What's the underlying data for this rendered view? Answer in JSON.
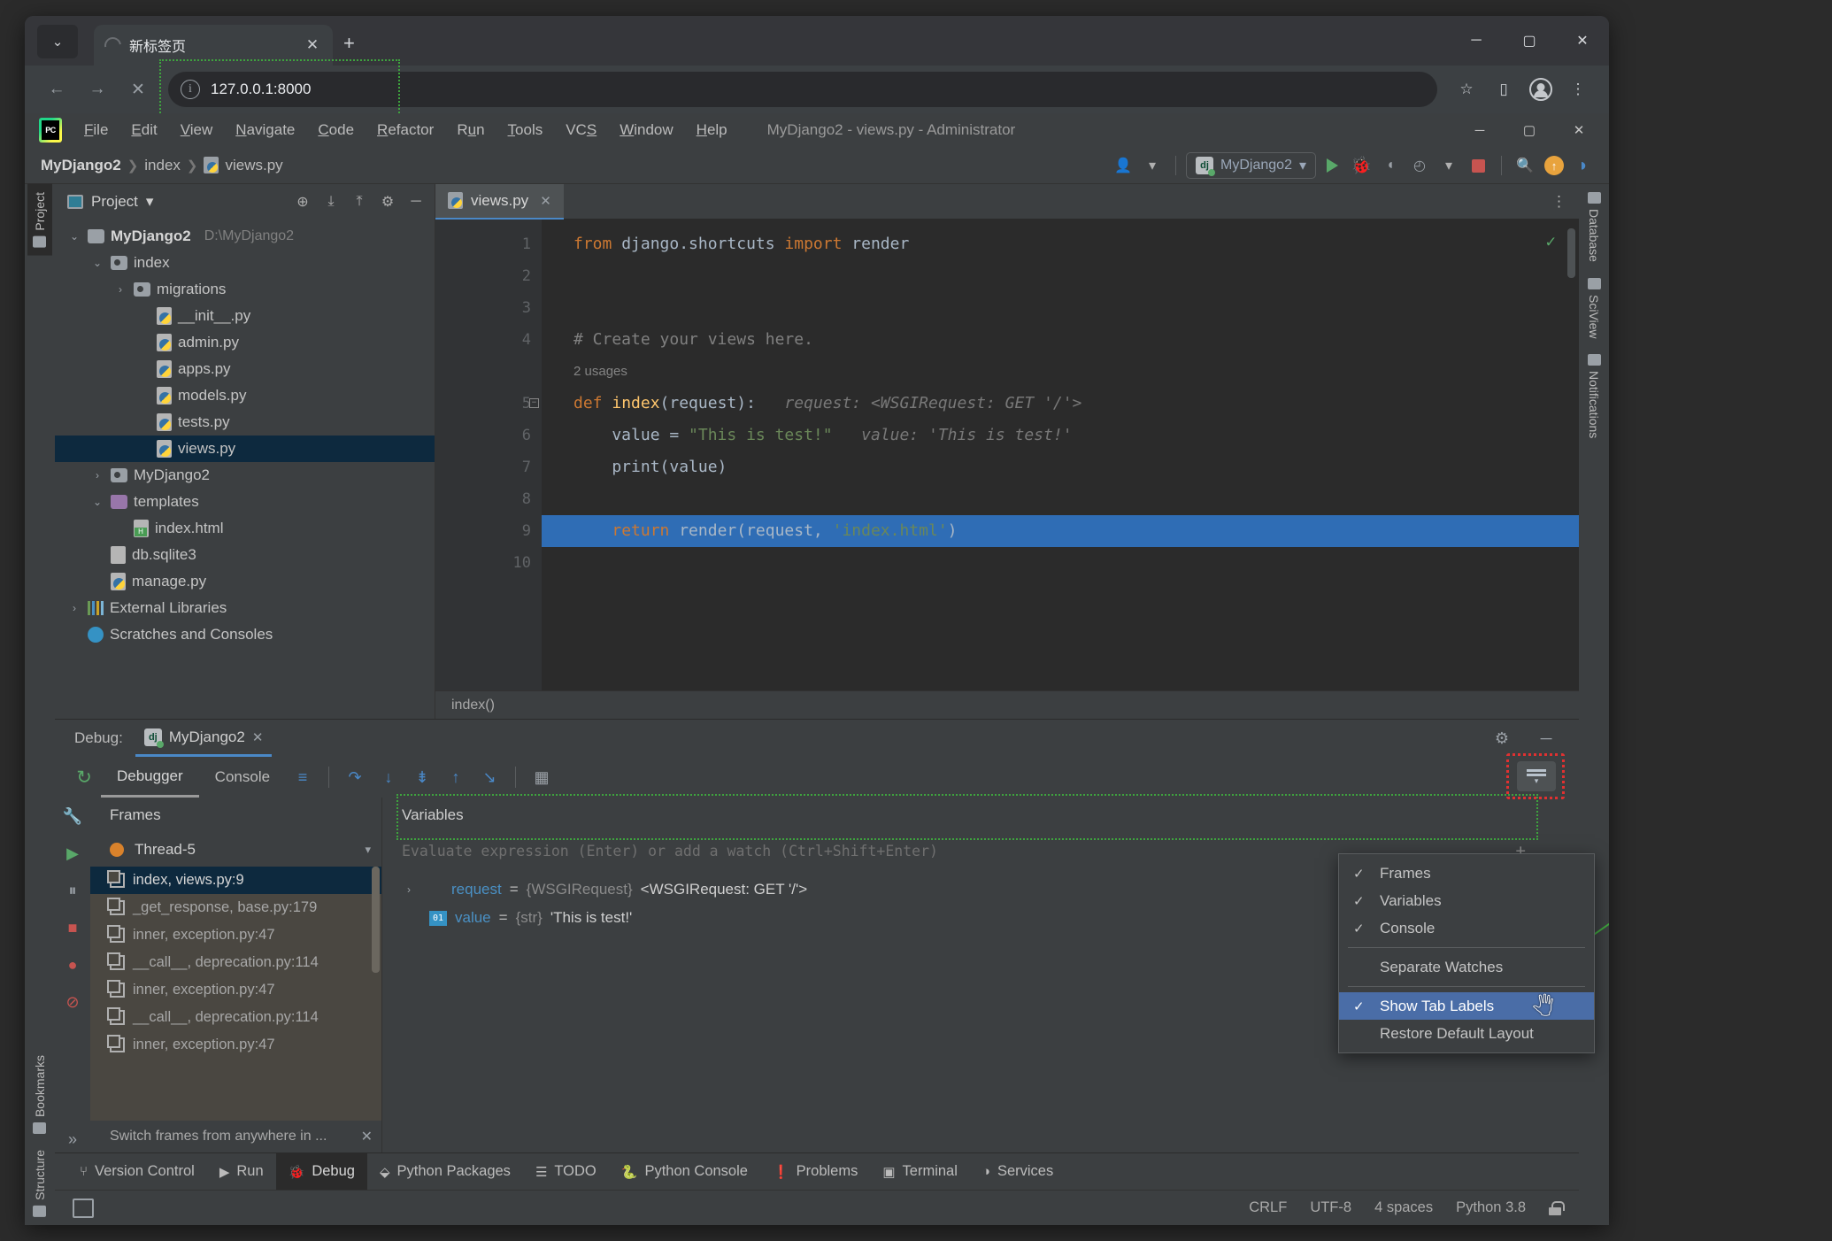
{
  "browser": {
    "tab_title": "新标签页",
    "tab_close": "✕",
    "new_tab": "+",
    "url": "127.0.0.1:8000",
    "info_icon": "i",
    "back": "←",
    "forward": "→",
    "stop": "✕",
    "star": "☆",
    "split": "▯",
    "menu": "⋮",
    "minimize": "─",
    "maximize": "▢",
    "close": "✕"
  },
  "ide": {
    "logo_text": "PC",
    "menu": [
      {
        "pre": "",
        "u": "F",
        "post": "ile"
      },
      {
        "pre": "",
        "u": "E",
        "post": "dit"
      },
      {
        "pre": "",
        "u": "V",
        "post": "iew"
      },
      {
        "pre": "",
        "u": "N",
        "post": "avigate"
      },
      {
        "pre": "",
        "u": "C",
        "post": "ode"
      },
      {
        "pre": "",
        "u": "R",
        "post": "efactor"
      },
      {
        "pre": "R",
        "u": "u",
        "post": "n"
      },
      {
        "pre": "",
        "u": "T",
        "post": "ools"
      },
      {
        "pre": "VC",
        "u": "S",
        "post": ""
      },
      {
        "pre": "",
        "u": "W",
        "post": "indow"
      },
      {
        "pre": "",
        "u": "H",
        "post": "elp"
      }
    ],
    "window_title": "MyDjango2 - views.py - Administrator",
    "win_minimize": "─",
    "win_maximize": "▢",
    "win_close": "✕"
  },
  "breadcrumb": {
    "project": "MyDjango2",
    "sep": "❯",
    "package": "index",
    "file": "views.py"
  },
  "toolbar": {
    "user_icon": "👤",
    "dropdown": "▾",
    "run_config": "MyDjango2",
    "dj_badge": "dj",
    "search_icon": "🔍",
    "update_icon": "↑"
  },
  "project_panel": {
    "title": "Project",
    "dropdown": "▾",
    "locate_icon": "⊕",
    "expand_icon": "⤓",
    "collapse_icon": "⤒",
    "settings_icon": "⚙",
    "hide_icon": "─",
    "tree": [
      {
        "depth": 0,
        "arrow": "⌄",
        "icon": "folder",
        "label": "MyDjango2",
        "bold": true,
        "path": "D:\\MyDjango2",
        "selected": false
      },
      {
        "depth": 1,
        "arrow": "⌄",
        "icon": "folder-mod",
        "label": "index",
        "bold": false,
        "path": "",
        "selected": false
      },
      {
        "depth": 2,
        "arrow": "›",
        "icon": "folder-mod",
        "label": "migrations",
        "bold": false,
        "path": "",
        "selected": false
      },
      {
        "depth": 3,
        "arrow": "",
        "icon": "py",
        "label": "__init__.py",
        "bold": false,
        "path": "",
        "selected": false
      },
      {
        "depth": 3,
        "arrow": "",
        "icon": "py",
        "label": "admin.py",
        "bold": false,
        "path": "",
        "selected": false
      },
      {
        "depth": 3,
        "arrow": "",
        "icon": "py",
        "label": "apps.py",
        "bold": false,
        "path": "",
        "selected": false
      },
      {
        "depth": 3,
        "arrow": "",
        "icon": "py",
        "label": "models.py",
        "bold": false,
        "path": "",
        "selected": false
      },
      {
        "depth": 3,
        "arrow": "",
        "icon": "py",
        "label": "tests.py",
        "bold": false,
        "path": "",
        "selected": false
      },
      {
        "depth": 3,
        "arrow": "",
        "icon": "py",
        "label": "views.py",
        "bold": false,
        "path": "",
        "selected": true
      },
      {
        "depth": 1,
        "arrow": "›",
        "icon": "folder-mod",
        "label": "MyDjango2",
        "bold": false,
        "path": "",
        "selected": false
      },
      {
        "depth": 1,
        "arrow": "⌄",
        "icon": "folder-purple",
        "label": "templates",
        "bold": false,
        "path": "",
        "selected": false
      },
      {
        "depth": 2,
        "arrow": "",
        "icon": "html",
        "label": "index.html",
        "bold": false,
        "path": "",
        "selected": false
      },
      {
        "depth": 1,
        "arrow": "",
        "icon": "db",
        "label": "db.sqlite3",
        "bold": false,
        "path": "",
        "selected": false
      },
      {
        "depth": 1,
        "arrow": "",
        "icon": "py",
        "label": "manage.py",
        "bold": false,
        "path": "",
        "selected": false
      },
      {
        "depth": 0,
        "arrow": "›",
        "icon": "lib",
        "label": "External Libraries",
        "bold": false,
        "path": "",
        "selected": false
      },
      {
        "depth": 0,
        "arrow": "",
        "icon": "scratch",
        "label": "Scratches and Consoles",
        "bold": false,
        "path": "",
        "selected": false
      }
    ]
  },
  "left_rail": [
    {
      "label": "Project",
      "active": true
    },
    {
      "label": "Bookmarks",
      "active": false
    },
    {
      "label": "Structure",
      "active": false
    }
  ],
  "right_rail": [
    {
      "label": "Database"
    },
    {
      "label": "SciView"
    },
    {
      "label": "Notifications"
    }
  ],
  "editor": {
    "tab_label": "views.py",
    "tab_close": "✕",
    "more_icon": "⋮",
    "inspection_ok": "✓",
    "usages_hint": "2 usages",
    "breadcrumb_bottom": "index()",
    "lines": [
      {
        "no": "1",
        "segments": [
          {
            "t": "from ",
            "c": "kw"
          },
          {
            "t": "django.shortcuts ",
            "c": ""
          },
          {
            "t": "import ",
            "c": "kw"
          },
          {
            "t": "render",
            "c": ""
          }
        ]
      },
      {
        "no": "2",
        "segments": []
      },
      {
        "no": "3",
        "segments": []
      },
      {
        "no": "4",
        "segments": [
          {
            "t": "# Create your views here.",
            "c": "cmt"
          }
        ]
      },
      {
        "no": "5",
        "segments": [
          {
            "t": "def ",
            "c": "kw"
          },
          {
            "t": "index",
            "c": "fn"
          },
          {
            "t": "(request):",
            "c": ""
          },
          {
            "t": "   request: <WSGIRequest: GET '/'>",
            "c": "hint"
          }
        ]
      },
      {
        "no": "6",
        "segments": [
          {
            "t": "    value = ",
            "c": ""
          },
          {
            "t": "\"This is test!\"",
            "c": "str"
          },
          {
            "t": "   value: 'This is test!'",
            "c": "hint"
          }
        ]
      },
      {
        "no": "7",
        "segments": [
          {
            "t": "    print(value)",
            "c": ""
          }
        ]
      },
      {
        "no": "8",
        "segments": []
      },
      {
        "no": "9",
        "segments": [
          {
            "t": "    ",
            "c": ""
          },
          {
            "t": "return ",
            "c": "kw"
          },
          {
            "t": "render(request, ",
            "c": ""
          },
          {
            "t": "'index.html'",
            "c": "str"
          },
          {
            "t": ")",
            "c": ""
          }
        ],
        "highlight": true,
        "breakpoint": true,
        "html_icon": true
      },
      {
        "no": "10",
        "segments": []
      }
    ]
  },
  "debug": {
    "label": "Debug:",
    "session": "MyDjango2",
    "session_close": "✕",
    "settings_icon": "⚙",
    "hide_icon": "─",
    "rerun_icon": "↻",
    "tabs": [
      {
        "label": "Debugger",
        "active": true
      },
      {
        "label": "Console",
        "active": false
      }
    ],
    "step_icons": [
      "≡",
      "↷",
      "↓",
      "⇟",
      "↑",
      "↘"
    ],
    "calc_icon": "▦",
    "left_rail_icons": [
      "🔧",
      "▶",
      "⏸",
      "■",
      "●",
      "⊘"
    ],
    "frames": {
      "header": "Frames",
      "thread": "Thread-5",
      "thread_dropdown": "▾",
      "items": [
        {
          "label": "index, views.py:9",
          "selected": true
        },
        {
          "label": "_get_response, base.py:179",
          "selected": false
        },
        {
          "label": "inner, exception.py:47",
          "selected": false
        },
        {
          "label": "__call__, deprecation.py:114",
          "selected": false
        },
        {
          "label": "inner, exception.py:47",
          "selected": false
        },
        {
          "label": "__call__, deprecation.py:114",
          "selected": false
        },
        {
          "label": "inner, exception.py:47",
          "selected": false
        }
      ],
      "footer": "Switch frames from anywhere in ...",
      "footer_close": "✕"
    },
    "variables": {
      "header": "Variables",
      "watch_placeholder": "Evaluate expression (Enter) or add a watch (Ctrl+Shift+Enter)",
      "add_watch": "+",
      "rows": [
        {
          "arrow": "›",
          "icon": "obj",
          "name": "request",
          "eq": " = ",
          "type": "{WSGIRequest}",
          "value": "<WSGIRequest: GET '/'>"
        },
        {
          "arrow": "",
          "icon": "str",
          "name": "value",
          "eq": " = ",
          "type": "{str}",
          "value": "'This is test!'"
        }
      ]
    }
  },
  "context_menu": {
    "items": [
      {
        "label": "Frames",
        "checked": true,
        "selected": false
      },
      {
        "label": "Variables",
        "checked": true,
        "selected": false
      },
      {
        "label": "Console",
        "checked": true,
        "selected": false
      },
      {
        "sep": true
      },
      {
        "label": "Separate Watches",
        "checked": false,
        "selected": false
      },
      {
        "sep": true
      },
      {
        "label": "Show Tab Labels",
        "checked": true,
        "selected": true
      },
      {
        "label": "Restore Default Layout",
        "checked": false,
        "selected": false
      }
    ],
    "check_glyph": "✓",
    "cursor": "🖑"
  },
  "tool_windows": [
    {
      "icon": "⑂",
      "label": "Version Control",
      "active": false
    },
    {
      "icon": "▶",
      "label": "Run",
      "active": false
    },
    {
      "icon": "🐞",
      "label": "Debug",
      "active": true
    },
    {
      "icon": "⬙",
      "label": "Python Packages",
      "active": false
    },
    {
      "icon": "☰",
      "label": "TODO",
      "active": false
    },
    {
      "icon": "🐍",
      "label": "Python Console",
      "active": false
    },
    {
      "icon": "❗",
      "label": "Problems",
      "active": false
    },
    {
      "icon": "▣",
      "label": "Terminal",
      "active": false
    },
    {
      "icon": "◑",
      "label": "Services",
      "active": false
    }
  ],
  "status_bar": {
    "line_sep": "CRLF",
    "encoding": "UTF-8",
    "indent": "4 spaces",
    "interpreter": "Python 3.8"
  },
  "colors": {
    "accent_blue": "#4a88c7",
    "selection_blue": "#2f6db5",
    "green_highlight": "#3ea33e",
    "red_highlight": "#e03131",
    "menu_select": "#4a6da7",
    "ide_bg": "#3c3f41",
    "editor_bg": "#2b2b2b"
  }
}
